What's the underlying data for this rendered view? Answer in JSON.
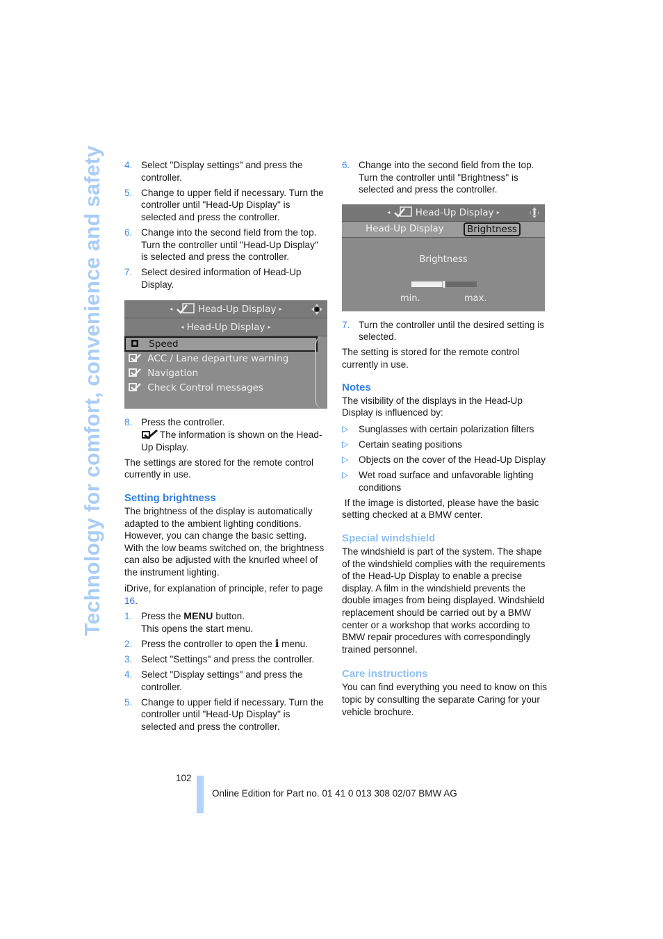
{
  "side_title": "Technology for comfort, convenience and safety",
  "left_column": {
    "steps_a": [
      {
        "num": "4.",
        "text": "Select \"Display settings\" and press the controller."
      },
      {
        "num": "5.",
        "text": "Change to upper field if necessary. Turn the controller until \"Head-Up Display\" is selected and press the controller."
      },
      {
        "num": "6.",
        "text": "Change into the second field from the top. Turn the controller until \"Head-Up Display\" is selected and press the controller."
      },
      {
        "num": "7.",
        "text": "Select desired information of Head-Up Display."
      }
    ],
    "screen1": {
      "top_title": "Head-Up Display",
      "second_title": "Head-Up Display",
      "items": [
        {
          "label": "Speed",
          "checked": false,
          "selected": true
        },
        {
          "label": "ACC / Lane departure warning",
          "checked": true,
          "selected": false
        },
        {
          "label": "Navigation",
          "checked": true,
          "selected": false
        },
        {
          "label": "Check Control messages",
          "checked": true,
          "selected": false
        }
      ]
    },
    "step8": {
      "num": "8.",
      "text": "Press the controller.",
      "subtext": "The information is shown on the Head-Up Display."
    },
    "stored_note": "The settings are stored for the remote control currently in use.",
    "brightness_heading": "Setting brightness",
    "brightness_para": "The brightness of the display is automatically adapted to the ambient lighting conditions. However, you can change the basic setting. With the low beams switched on, the brightness can also be adjusted with the knurled wheel of the instrument lighting.",
    "idrive_ref_prefix": "iDrive, for explanation of principle, refer to page ",
    "idrive_ref_page": "16",
    "idrive_ref_suffix": ".",
    "steps_b": [
      {
        "num": "1.",
        "pre": "Press the ",
        "key": "MENU",
        "post": " button.",
        "sub": "This opens the start menu."
      },
      {
        "num": "2.",
        "pre": "Press the controller to open the ",
        "key": "i",
        "post": " menu."
      },
      {
        "num": "3.",
        "text": "Select \"Settings\" and press the controller."
      },
      {
        "num": "4.",
        "text": "Select \"Display settings\" and press the controller."
      },
      {
        "num": "5.",
        "text": "Change to upper field if necessary. Turn the controller until \"Head-Up Display\" is selected and press the controller."
      }
    ]
  },
  "right_column": {
    "step6": {
      "num": "6.",
      "text": "Change into the second field from the top. Turn the controller until \"Brightness\" is selected and press the controller."
    },
    "screen2": {
      "top_title": "Head-Up Display",
      "tab_left": "Head-Up Display",
      "tab_right": "Brightness",
      "label": "Brightness",
      "min_label": "min.",
      "max_label": "max.",
      "brightness_level_fraction": 0.5
    },
    "step7": {
      "num": "7.",
      "text": "Turn the controller until the desired setting is selected."
    },
    "stored_note": "The setting is stored for the remote control currently in use.",
    "notes_heading": "Notes",
    "notes_intro": "The visibility of the displays in the Head-Up Display is influenced by:",
    "notes_bullets": [
      "Sunglasses with certain polarization filters",
      "Certain seating positions",
      "Objects on the cover of the Head-Up Display",
      "Wet road surface and unfavorable lighting conditions"
    ],
    "notes_outro": " If the image is distorted, please have the basic setting checked at a BMW center.",
    "windshield_heading": "Special windshield",
    "windshield_para": "The windshield is part of the system. The shape of the windshield complies with the requirements of the Head-Up Display to enable a precise display. A film in the windshield prevents the double images from being displayed. Windshield replacement should be carried out by a BMW center or a workshop that works according to BMW repair procedures with correspondingly trained personnel.",
    "care_heading": "Care instructions",
    "care_para": "You can find everything you need to know on this topic by consulting the separate Caring for your vehicle brochure."
  },
  "footer": {
    "page_number": "102",
    "edition_text": "Online Edition for Part no. 01 41 0 013 308 02/07 BMW AG"
  },
  "colors": {
    "accent_blue": "#2f7fe0",
    "light_blue": "#a9cdf5",
    "screen_gray": "#8c8c8c"
  }
}
